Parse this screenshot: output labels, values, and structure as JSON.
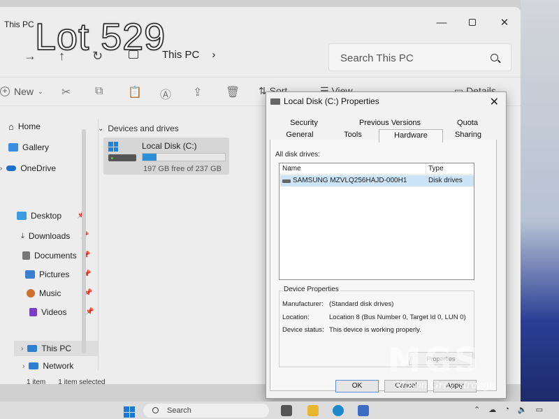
{
  "overlay": {
    "lot_label": "Lot 529"
  },
  "explorer": {
    "window_title": "This PC",
    "window_controls": {
      "minimize": "—",
      "maximize": "",
      "close": "✕"
    },
    "address": {
      "segments": [
        "This PC"
      ],
      "separator": "›"
    },
    "search": {
      "placeholder": "Search This PC"
    },
    "toolbar": {
      "new_label": "New",
      "sort_label": "Sort",
      "view_label": "View",
      "details_label": "Details"
    },
    "sidebar": {
      "items": [
        {
          "label": "Home"
        },
        {
          "label": "Gallery"
        },
        {
          "label": "OneDrive"
        },
        {
          "label": "Desktop"
        },
        {
          "label": "Downloads"
        },
        {
          "label": "Documents"
        },
        {
          "label": "Pictures"
        },
        {
          "label": "Music"
        },
        {
          "label": "Videos"
        },
        {
          "label": "This PC"
        },
        {
          "label": "Network"
        }
      ]
    },
    "content": {
      "group_header": "Devices and drives",
      "drive": {
        "label": "Local Disk (C:)",
        "free_text": "197 GB free of 237 GB",
        "used_fraction": 0.17
      }
    },
    "status": {
      "items": "1 item",
      "selected": "1 item selected"
    }
  },
  "dialog": {
    "title": "Local Disk (C:) Properties",
    "close": "✕",
    "tabs_row1": [
      "Security",
      "Previous Versions",
      "Quota"
    ],
    "tabs_row2": [
      "General",
      "Tools",
      "Hardware",
      "Sharing"
    ],
    "active_tab": "Hardware",
    "all_disk_drives_label": "All disk drives:",
    "list": {
      "columns": [
        "Name",
        "Type"
      ],
      "rows": [
        {
          "name": "SAMSUNG MZVLQ256HAJD-000H1",
          "type": "Disk drives"
        }
      ]
    },
    "device_properties": {
      "legend": "Device Properties",
      "manufacturer_label": "Manufacturer:",
      "manufacturer_value": "(Standard disk drives)",
      "location_label": "Location:",
      "location_value": "Location 8 (Bus Number 0, Target Id 0, LUN 0)",
      "status_label": "Device status:",
      "status_value": "This device is working properly.",
      "properties_button": "Properties"
    },
    "buttons": {
      "ok": "OK",
      "cancel": "Cancel",
      "apply": "Apply"
    }
  },
  "watermark": {
    "big": "MGS",
    "small": "Mason Gray Strange"
  },
  "taskbar": {
    "search_label": "Search"
  },
  "colors": {
    "accent": "#1f84d8",
    "selection": "#cce4f7",
    "drive_bar": "#2b8fd6"
  }
}
